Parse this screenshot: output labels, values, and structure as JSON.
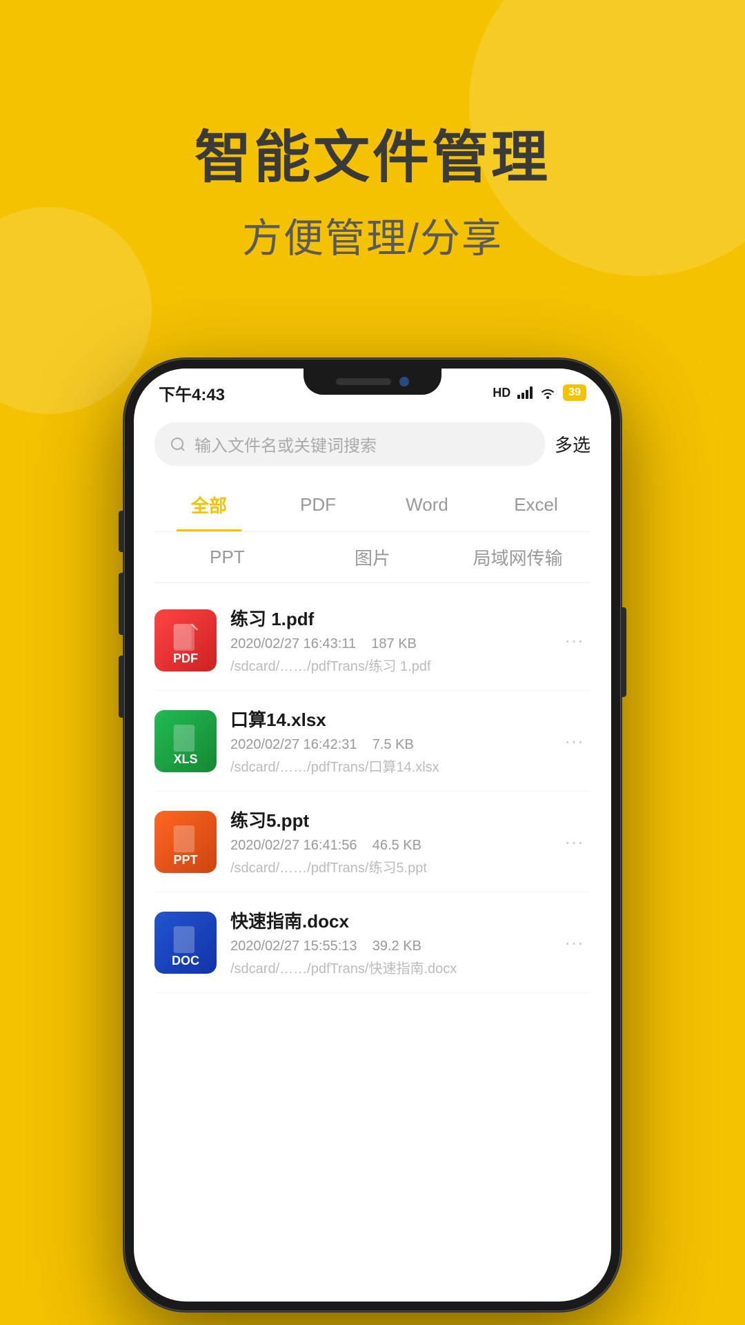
{
  "background_color": "#F5C200",
  "header": {
    "main_title": "智能文件管理",
    "sub_title": "方便管理/分享"
  },
  "status_bar": {
    "time": "下午4:43",
    "battery": "39",
    "hd_label": "HD"
  },
  "search": {
    "placeholder": "输入文件名或关键词搜索",
    "multi_select": "多选"
  },
  "tabs_row1": [
    {
      "label": "全部",
      "active": true
    },
    {
      "label": "PDF",
      "active": false
    },
    {
      "label": "Word",
      "active": false
    },
    {
      "label": "Excel",
      "active": false
    }
  ],
  "tabs_row2": [
    {
      "label": "PPT"
    },
    {
      "label": "图片"
    },
    {
      "label": "局域网传输"
    }
  ],
  "files": [
    {
      "name": "练习 1.pdf",
      "date": "2020/02/27 16:43:11",
      "size": "187 KB",
      "path": "/sdcard/……/pdfTrans/练习 1.pdf",
      "type": "pdf",
      "type_label": "PDF"
    },
    {
      "name": "口算14.xlsx",
      "date": "2020/02/27 16:42:31",
      "size": "7.5 KB",
      "path": "/sdcard/……/pdfTrans/口算14.xlsx",
      "type": "xls",
      "type_label": "XLS"
    },
    {
      "name": "练习5.ppt",
      "date": "2020/02/27 16:41:56",
      "size": "46.5 KB",
      "path": "/sdcard/……/pdfTrans/练习5.ppt",
      "type": "ppt",
      "type_label": "PPT"
    },
    {
      "name": "快速指南.docx",
      "date": "2020/02/27 15:55:13",
      "size": "39.2 KB",
      "path": "/sdcard/……/pdfTrans/快速指南.docx",
      "type": "doc",
      "type_label": "DOC"
    }
  ]
}
